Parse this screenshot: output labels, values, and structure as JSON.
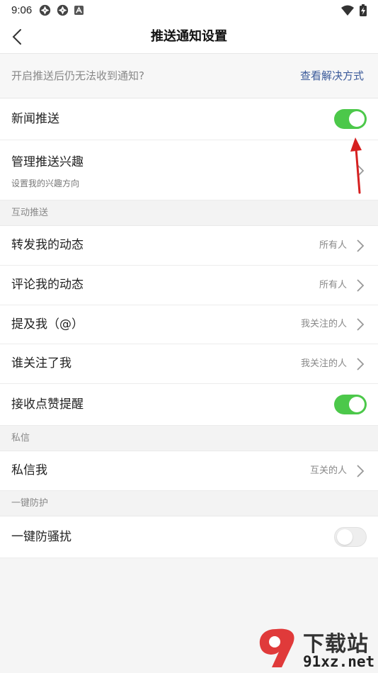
{
  "status_bar": {
    "time": "9:06",
    "left_icons": [
      "aperture-icon",
      "aperture-icon",
      "app-a-icon"
    ],
    "right_icons": [
      "wifi-icon",
      "battery-charging-icon"
    ]
  },
  "navbar": {
    "title": "推送通知设置",
    "back_icon": "chevron-left-icon"
  },
  "notice": {
    "text": "开启推送后仍无法收到通知?",
    "link": "查看解决方式",
    "link_color": "#3b5a9a"
  },
  "rows_top": {
    "news_push": {
      "label": "新闻推送",
      "enabled": true
    },
    "manage_interests": {
      "label": "管理推送兴趣",
      "sub": "设置我的兴趣方向"
    }
  },
  "interaction_section": {
    "title": "互动推送",
    "items": [
      {
        "label": "转发我的动态",
        "value": "所有人"
      },
      {
        "label": "评论我的动态",
        "value": "所有人"
      },
      {
        "label": "提及我（@）",
        "value": "我关注的人"
      },
      {
        "label": "谁关注了我",
        "value": "我关注的人"
      }
    ],
    "like_reminder": {
      "label": "接收点赞提醒",
      "enabled": true
    }
  },
  "private_section": {
    "title": "私信",
    "item": {
      "label": "私信我",
      "value": "互关的人"
    }
  },
  "protection_section": {
    "title": "一键防护",
    "item": {
      "label": "一键防骚扰",
      "enabled": false
    }
  },
  "colors": {
    "toggle_on": "#4cc84a",
    "toggle_off": "#eeeeee",
    "annotation_arrow": "#d62020",
    "watermark_red": "#e03a3a"
  },
  "watermark": {
    "title": "下载站",
    "domain": "91xz.net"
  }
}
